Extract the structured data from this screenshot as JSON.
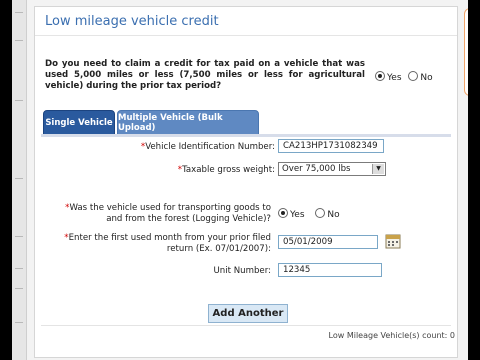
{
  "panel": {
    "title": "Low mileage vehicle credit"
  },
  "question": {
    "text": "Do you need to claim a credit for tax paid on a vehicle that was used 5,000 miles or less (7,500 miles or less for agricultural vehicle) during the prior tax period?",
    "yes": "Yes",
    "no": "No",
    "selected": "Yes"
  },
  "tabs": [
    {
      "label": "Single Vehicle",
      "active": true
    },
    {
      "label": "Multiple Vehicle (Bulk Upload)",
      "active": false
    }
  ],
  "form": {
    "required_mark": "*",
    "vin": {
      "label": "Vehicle Identification Number:",
      "value": "CA213HP1731082349"
    },
    "weight": {
      "label": "Taxable gross weight:",
      "value": "Over 75,000 lbs"
    },
    "logging": {
      "label_line1": "Was the vehicle used for transporting goods to",
      "label_line2": "and from the forest (Logging Vehicle)?",
      "yes": "Yes",
      "no": "No",
      "selected": "Yes"
    },
    "first_month": {
      "label_line1": "Enter the first used month from your prior filed",
      "label_line2": "return (Ex. 07/01/2007):",
      "value": "05/01/2009"
    },
    "unit": {
      "label": "Unit Number:",
      "value": "12345"
    }
  },
  "actions": {
    "add_another": "Add Another"
  },
  "footer": {
    "count_label": "Low Mileage Vehicle(s) count: 0"
  }
}
